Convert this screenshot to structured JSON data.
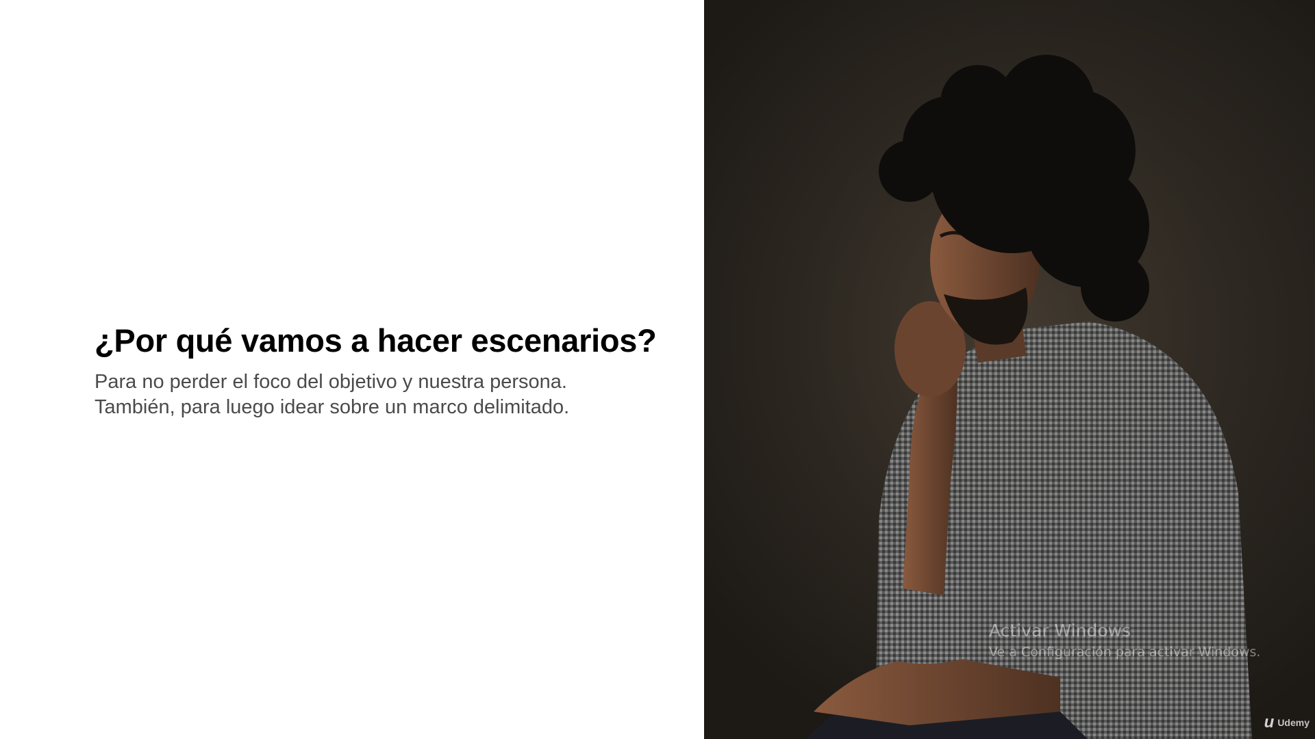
{
  "slide": {
    "title": "¿Por qué vamos a hacer escenarios?",
    "body_lines": [
      "Para no perder el foco del objetivo y nuestra persona.",
      "También, para luego idear sobre un marco delimitado."
    ]
  },
  "watermark": {
    "title": "Activar Windows",
    "subtitle": "Ve a Configuración para activar Windows."
  },
  "brand": {
    "icon": "udemy-logo-icon",
    "label": "Udemy"
  },
  "colors": {
    "title": "#000000",
    "body": "#4a4a4a",
    "photo_background": "#2b2620"
  }
}
